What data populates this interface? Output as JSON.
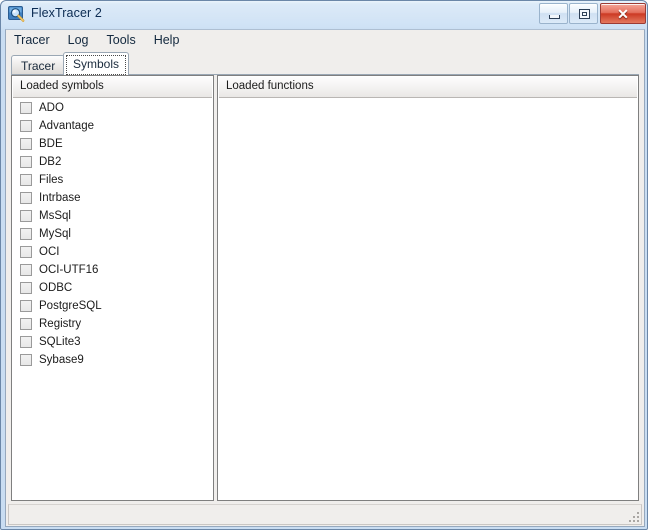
{
  "window": {
    "title": "FlexTracer 2",
    "icon": "magnifier-app-icon",
    "controls": {
      "minimize_label": "–",
      "maximize_label": "□",
      "close_label": "✕"
    },
    "colors": {
      "title_bar_gradient_top": "#eaf3fc",
      "title_bar_gradient_bottom": "#c9ddf2",
      "frame_border": "#6b87a8",
      "close_button": "#cc3a24",
      "client_background": "#f0eeec",
      "panel_background": "#ffffff",
      "panel_border": "#7f7f7f",
      "text": "#1b1b1b"
    }
  },
  "menu": {
    "items": [
      {
        "label": "Tracer"
      },
      {
        "label": "Log"
      },
      {
        "label": "Tools"
      },
      {
        "label": "Help"
      }
    ]
  },
  "tabs": {
    "items": [
      {
        "label": "Tracer",
        "active": false
      },
      {
        "label": "Symbols",
        "active": true
      }
    ],
    "active_index": 1
  },
  "panels": {
    "symbols": {
      "header": "Loaded symbols",
      "items": [
        {
          "label": "ADO",
          "checked": false
        },
        {
          "label": "Advantage",
          "checked": false
        },
        {
          "label": "BDE",
          "checked": false
        },
        {
          "label": "DB2",
          "checked": false
        },
        {
          "label": "Files",
          "checked": false
        },
        {
          "label": "Intrbase",
          "checked": false
        },
        {
          "label": "MsSql",
          "checked": false
        },
        {
          "label": "MySql",
          "checked": false
        },
        {
          "label": "OCI",
          "checked": false
        },
        {
          "label": "OCI-UTF16",
          "checked": false
        },
        {
          "label": "ODBC",
          "checked": false
        },
        {
          "label": "PostgreSQL",
          "checked": false
        },
        {
          "label": "Registry",
          "checked": false
        },
        {
          "label": "SQLite3",
          "checked": false
        },
        {
          "label": "Sybase9",
          "checked": false
        }
      ]
    },
    "functions": {
      "header": "Loaded functions",
      "items": []
    }
  },
  "status_bar": {
    "text": "",
    "grip": "resize-grip"
  }
}
